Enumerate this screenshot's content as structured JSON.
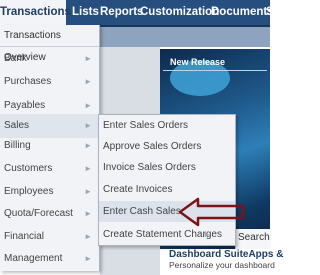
{
  "topnav": {
    "tabs": [
      {
        "label": "Transactions"
      },
      {
        "label": "Lists"
      },
      {
        "label": "Reports"
      },
      {
        "label": "Customization"
      },
      {
        "label": "Documents"
      },
      {
        "label": "S"
      }
    ]
  },
  "menu": {
    "overview": "Transactions Overview",
    "items": [
      {
        "label": "Bank"
      },
      {
        "label": "Purchases"
      },
      {
        "label": "Payables"
      },
      {
        "label": "Sales"
      },
      {
        "label": "Billing"
      },
      {
        "label": "Customers"
      },
      {
        "label": "Employees"
      },
      {
        "label": "Quota/Forecast"
      },
      {
        "label": "Financial"
      },
      {
        "label": "Management"
      }
    ],
    "arrow_glyph": "►"
  },
  "submenu": {
    "items": [
      {
        "label": "Enter Sales Orders"
      },
      {
        "label": "Approve Sales Orders"
      },
      {
        "label": "Invoice Sales Orders"
      },
      {
        "label": "Create Invoices"
      },
      {
        "label": "Enter Cash Sales"
      },
      {
        "label": "Create Statement Charges"
      }
    ]
  },
  "background": {
    "banner_title": "New Release",
    "search_label": "Search",
    "side_fragment": "it",
    "dashboard_title": "Dashboard SuiteApps &",
    "dashboard_subtitle": "Personalize your dashboard"
  },
  "colors": {
    "nav_bg": "#264f7f",
    "menu_bg": "#f1f3f6",
    "annotation_arrow": "#7a1417"
  }
}
